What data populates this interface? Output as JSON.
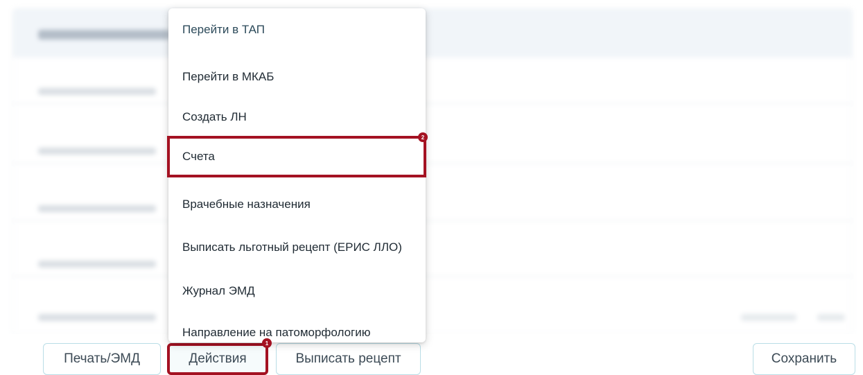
{
  "menu": {
    "items": [
      "Перейти в ТАП",
      "Перейти в МКАБ",
      "Создать ЛН",
      "Счета",
      "Врачебные назначения",
      "Выписать льготный рецепт (ЕРИС ЛЛО)",
      "Журнал ЭМД",
      "Направление на патоморфологию"
    ],
    "highlighted_index": 3
  },
  "toolbar": {
    "print_label": "Печать/ЭМД",
    "actions_label": "Действия",
    "recipe_label": "Выписать рецепт",
    "save_label": "Сохранить"
  },
  "annotations": {
    "badge_1": "1",
    "badge_2": "2"
  },
  "colors": {
    "highlight": "#a41222",
    "button_border": "#b9dde6"
  }
}
